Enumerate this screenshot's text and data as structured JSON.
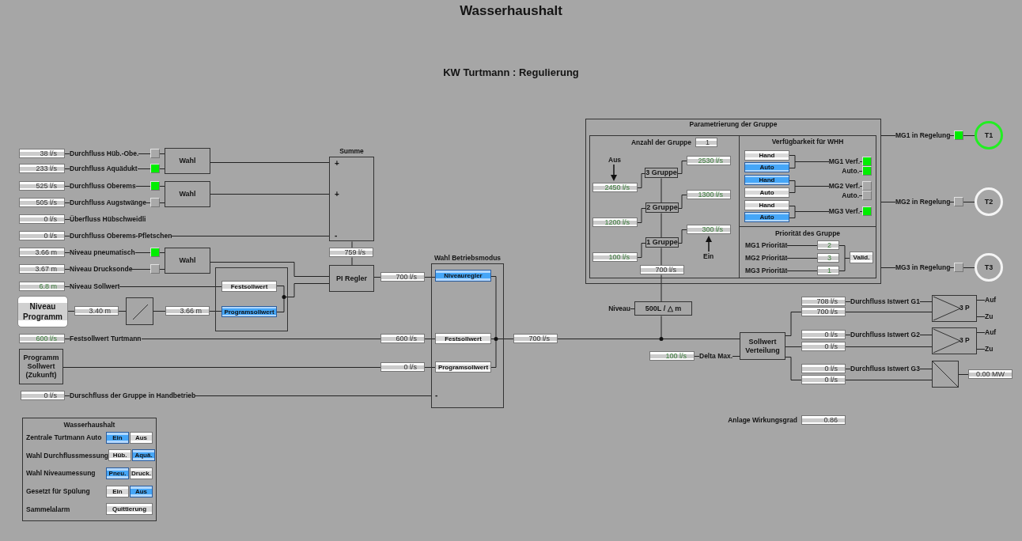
{
  "title": "Wasserhaushalt",
  "subtitle": "KW Turtmann : Regulierung",
  "sources": [
    {
      "value": "38 l/s",
      "editable": false,
      "label": "Durchfluss Hüb.-Obe.",
      "on": false
    },
    {
      "value": "233 l/s",
      "editable": false,
      "label": "Durchfluss Aquädukt",
      "on": true
    },
    {
      "value": "525 l/s",
      "editable": false,
      "label": "Durchfluss Oberems",
      "on": true
    },
    {
      "value": "505 l/s",
      "editable": false,
      "label": "Durchfluss Augstwänge",
      "on": false
    },
    {
      "value": "0 l/s",
      "editable": false,
      "label": "Überfluss Hübschweidli"
    },
    {
      "value": "0 l/s",
      "editable": false,
      "label": "Durchfluss Oberems-Pfletschen"
    },
    {
      "value": "3.66 m",
      "editable": false,
      "label": "Niveau pneumatisch",
      "on": true
    },
    {
      "value": "3.67 m",
      "editable": false,
      "label": "Niveau Drucksonde",
      "on": false
    },
    {
      "value": "6.8 m",
      "editable": true,
      "label": "Niveau Sollwert"
    }
  ],
  "wahl_blocks": [
    {
      "label": "Wahl"
    },
    {
      "label": "Wahl"
    },
    {
      "label": "Wahl"
    }
  ],
  "summe": {
    "title": "Summe",
    "signs": [
      "+",
      "+",
      "-"
    ],
    "output": {
      "value": "759 l/s",
      "editable": false
    }
  },
  "pi_regler": {
    "label": "PI Regler",
    "output": {
      "value": "700 l/s",
      "editable": false
    }
  },
  "niveau_programm": {
    "label": "Niveau Programm",
    "value": {
      "value": "3.40 m",
      "editable": false
    },
    "converted": {
      "value": "3.66 m",
      "editable": false
    }
  },
  "sollwert_choice": [
    {
      "label": "Festsollwert",
      "selected": false
    },
    {
      "label": "Programsollwert",
      "selected": true
    }
  ],
  "festsollwert": {
    "field": {
      "value": "600 l/s",
      "editable": true
    },
    "label": "Festsollwert Turtmann",
    "input": {
      "value": "600 l/s",
      "editable": false
    }
  },
  "programm_sollwert": {
    "label": "Programm Sollwert (Zukunft)",
    "input": {
      "value": "0 l/s",
      "editable": false
    }
  },
  "handbetrieb": {
    "field": {
      "value": "0 l/s",
      "editable": false
    },
    "label": "Durschfluss der Gruppe in Handbetrieb"
  },
  "betriebsmodus": {
    "title": "Wahl Betriebsmodus",
    "modes": [
      {
        "label": "Niveauregler",
        "selected": true
      },
      {
        "label": "Festsollwert",
        "selected": false
      },
      {
        "label": "Programsollwert",
        "selected": false
      }
    ],
    "minus": "-",
    "output": {
      "value": "700 l/s",
      "editable": false
    }
  },
  "parametrierung": {
    "title": "Parametrierung der Gruppe",
    "anzahl": {
      "label": "Anzahl der Gruppe",
      "field": {
        "value": "1",
        "editable": false
      }
    },
    "aus": "Aus",
    "ein": "Ein",
    "groups": [
      {
        "label": "3 Gruppe",
        "threshold_off": {
          "value": "2450 l/s",
          "editable": true
        },
        "threshold_on": {
          "value": "2530 l/s",
          "editable": true
        }
      },
      {
        "label": "2 Gruppe",
        "threshold_off": {
          "value": "1200 l/s",
          "editable": true
        },
        "threshold_on": {
          "value": "1300 l/s",
          "editable": true
        }
      },
      {
        "label": "1 Gruppe",
        "threshold_off": {
          "value": "100 l/s",
          "editable": true
        },
        "threshold_on": {
          "value": "300 l/s",
          "editable": true
        }
      }
    ],
    "total": {
      "value": "700 l/s",
      "editable": false
    },
    "verfuegbarkeit": {
      "title": "Verfügbarkeit für WHH",
      "units": [
        {
          "buttons": [
            {
              "label": "Hand",
              "selected": false
            },
            {
              "label": "Auto",
              "selected": true
            }
          ],
          "label": "MG1 Verf.",
          "on": true,
          "auto_label": "Auto.",
          "auto_on": true
        },
        {
          "buttons": [
            {
              "label": "Hand",
              "selected": true
            },
            {
              "label": "Auto",
              "selected": false
            }
          ],
          "label": "MG2 Verf.",
          "on": false,
          "auto_label": "Auto.",
          "auto_on": false
        },
        {
          "buttons": [
            {
              "label": "Hand",
              "selected": false
            },
            {
              "label": "Auto",
              "selected": true
            }
          ],
          "label": "MG3 Verf.",
          "on": true
        }
      ]
    },
    "prioritaet": {
      "title": "Priorität des Gruppe",
      "rows": [
        {
          "label": "MG1 Priorität",
          "field": {
            "value": "2",
            "editable": true
          }
        },
        {
          "label": "MG2 Priorität",
          "field": {
            "value": "3",
            "editable": true
          }
        },
        {
          "label": "MG3 Priorität",
          "field": {
            "value": "1",
            "editable": true
          }
        }
      ],
      "validate": "Valid."
    }
  },
  "niveau": {
    "label": "Niveau",
    "block": "500L / △ m"
  },
  "machines": [
    {
      "label": "MG1 in Regelung",
      "on": true,
      "turbine": "T1",
      "active": true
    },
    {
      "label": "MG2 in Regelung",
      "on": false,
      "turbine": "T2",
      "active": false
    },
    {
      "label": "MG3 in Regelung",
      "on": false,
      "turbine": "T3",
      "active": false
    }
  ],
  "verteilung": {
    "label": "Sollwert Verteilung",
    "delta": {
      "field": {
        "value": "100 l/s",
        "editable": true
      },
      "label": "Delta Max."
    },
    "groups": [
      {
        "kind": "three_point",
        "actual": {
          "value": "708 l/s",
          "editable": false
        },
        "setpoint": {
          "value": "700 l/s",
          "editable": false
        },
        "label": "Durchfluss Istwert G1",
        "block": "3 P",
        "outputs": [
          "Auf",
          "Zu"
        ]
      },
      {
        "kind": "three_point",
        "actual": {
          "value": "0 l/s",
          "editable": false
        },
        "setpoint": {
          "value": "0 l/s",
          "editable": false
        },
        "label": "Durchfluss Istwert G2",
        "block": "3 P",
        "outputs": [
          "Auf",
          "Zu"
        ]
      },
      {
        "kind": "converter",
        "actual": {
          "value": "0 l/s",
          "editable": false
        },
        "setpoint": {
          "value": "0 l/s",
          "editable": false
        },
        "label": "Durchfluss Istwert G3",
        "output": {
          "value": "0.00 MW",
          "editable": false
        }
      }
    ]
  },
  "wirkungsgrad": {
    "label": "Anlage Wirkungsgrad",
    "field": {
      "value": "0.86",
      "editable": false
    }
  },
  "panel": {
    "title": "Wasserhaushalt",
    "rows": [
      {
        "label": "Zentrale Turtmann Auto",
        "buttons": [
          {
            "label": "Ein",
            "selected": true
          },
          {
            "label": "Aus",
            "selected": false
          }
        ]
      },
      {
        "label": "Wahl Durchflussmessung",
        "buttons": [
          {
            "label": "Hüb.",
            "selected": false
          },
          {
            "label": "Aquä.",
            "selected": true
          }
        ]
      },
      {
        "label": "Wahl Niveaumessung",
        "buttons": [
          {
            "label": "Pneu.",
            "selected": true
          },
          {
            "label": "Druck.",
            "selected": false
          }
        ]
      },
      {
        "label": "Gesetzt für Spülung",
        "buttons": [
          {
            "label": "Ein",
            "selected": false
          },
          {
            "label": "Aus",
            "selected": true
          }
        ]
      },
      {
        "label": "Sammelalarm",
        "buttons": [
          {
            "label": "Quittierung",
            "selected": false
          }
        ]
      }
    ]
  }
}
